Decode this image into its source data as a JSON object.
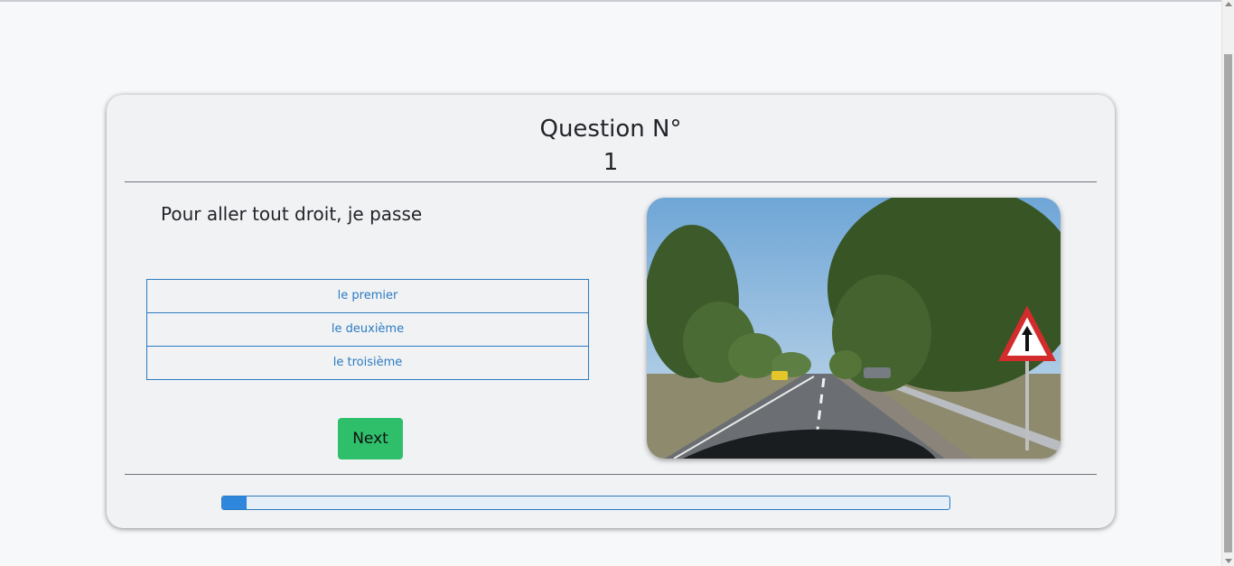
{
  "quiz": {
    "title_line1": "Question N°",
    "title_line2": "1",
    "question": "Pour aller tout droit, je passe",
    "answers": [
      "le premier",
      "le deuxième",
      "le troisième"
    ],
    "next_label": "Next",
    "progress_fraction": 0.033
  },
  "colors": {
    "accent": "#2b7bc2",
    "next_button": "#2fbf6b",
    "progress_fill": "#2f86dd"
  }
}
